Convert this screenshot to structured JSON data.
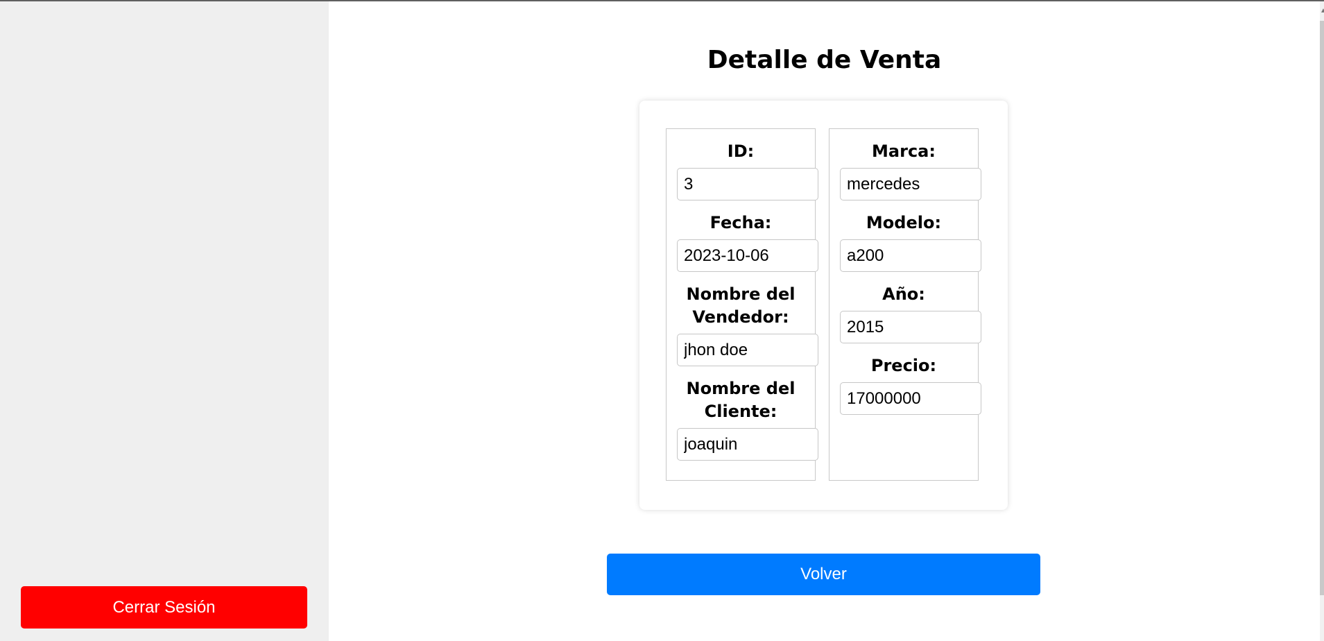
{
  "sidebar": {
    "logout_label": "Cerrar Sesión",
    "logout_color": "#ff0000"
  },
  "main": {
    "title": "Detalle de Venta",
    "left_fields": [
      {
        "label": "ID:",
        "value": "3"
      },
      {
        "label": "Fecha:",
        "value": "2023-10-06"
      },
      {
        "label": "Nombre del Vendedor:",
        "value": "jhon doe"
      },
      {
        "label": "Nombre del Cliente:",
        "value": "joaquin"
      }
    ],
    "right_fields": [
      {
        "label": "Marca:",
        "value": "mercedes"
      },
      {
        "label": "Modelo:",
        "value": "a200"
      },
      {
        "label": "Año:",
        "value": "2015"
      },
      {
        "label": "Precio:",
        "value": "17000000"
      }
    ],
    "back_label": "Volver",
    "back_color": "#007bff"
  }
}
